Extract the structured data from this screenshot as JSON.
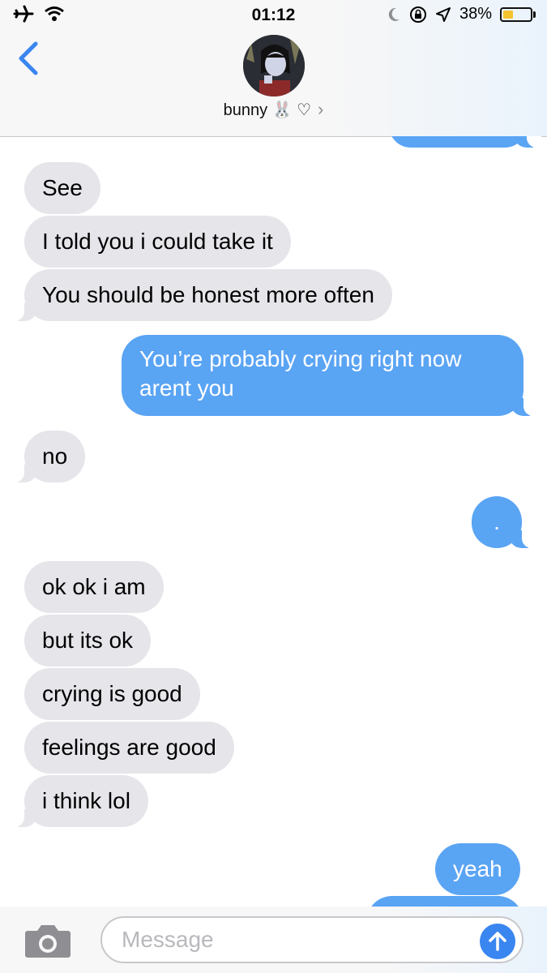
{
  "status_bar": {
    "time": "01:12",
    "battery_percent": "38%",
    "battery_level": 0.38,
    "icons": [
      "airplane-icon",
      "wifi-icon",
      "moon-icon",
      "orientation-lock-icon",
      "location-icon",
      "battery-icon"
    ]
  },
  "header": {
    "contact_name": "bunny 🐰 ♡",
    "chevron": "›",
    "back_icon": "chevron-left-icon"
  },
  "messages": [
    {
      "side": "outgoing",
      "text": ""
    },
    {
      "side": "incoming",
      "text": "See"
    },
    {
      "side": "incoming",
      "text": "I told you i could take it"
    },
    {
      "side": "incoming",
      "text": "You should be honest more often"
    },
    {
      "side": "outgoing",
      "text": "You’re probably crying right now aren’t you",
      "line1": "You’re probably crying right now",
      "line2": "arent you"
    },
    {
      "side": "incoming",
      "text": "no"
    },
    {
      "side": "outgoing",
      "text": "."
    },
    {
      "side": "incoming",
      "text": "ok ok i am"
    },
    {
      "side": "incoming",
      "text": "but its ok"
    },
    {
      "side": "incoming",
      "text": "crying is good"
    },
    {
      "side": "incoming",
      "text": "feelings are good"
    },
    {
      "side": "incoming",
      "text": "i think lol"
    },
    {
      "side": "outgoing",
      "text": "yeah"
    },
    {
      "side": "outgoing",
      "text": ""
    }
  ],
  "input": {
    "placeholder": "Message",
    "value": "",
    "camera_icon": "camera-icon",
    "send_icon": "arrow-up-icon"
  },
  "colors": {
    "incoming_bubble": "#e5e5ea",
    "outgoing_bubble": "#5aa4f4",
    "accent": "#3a86f0"
  }
}
